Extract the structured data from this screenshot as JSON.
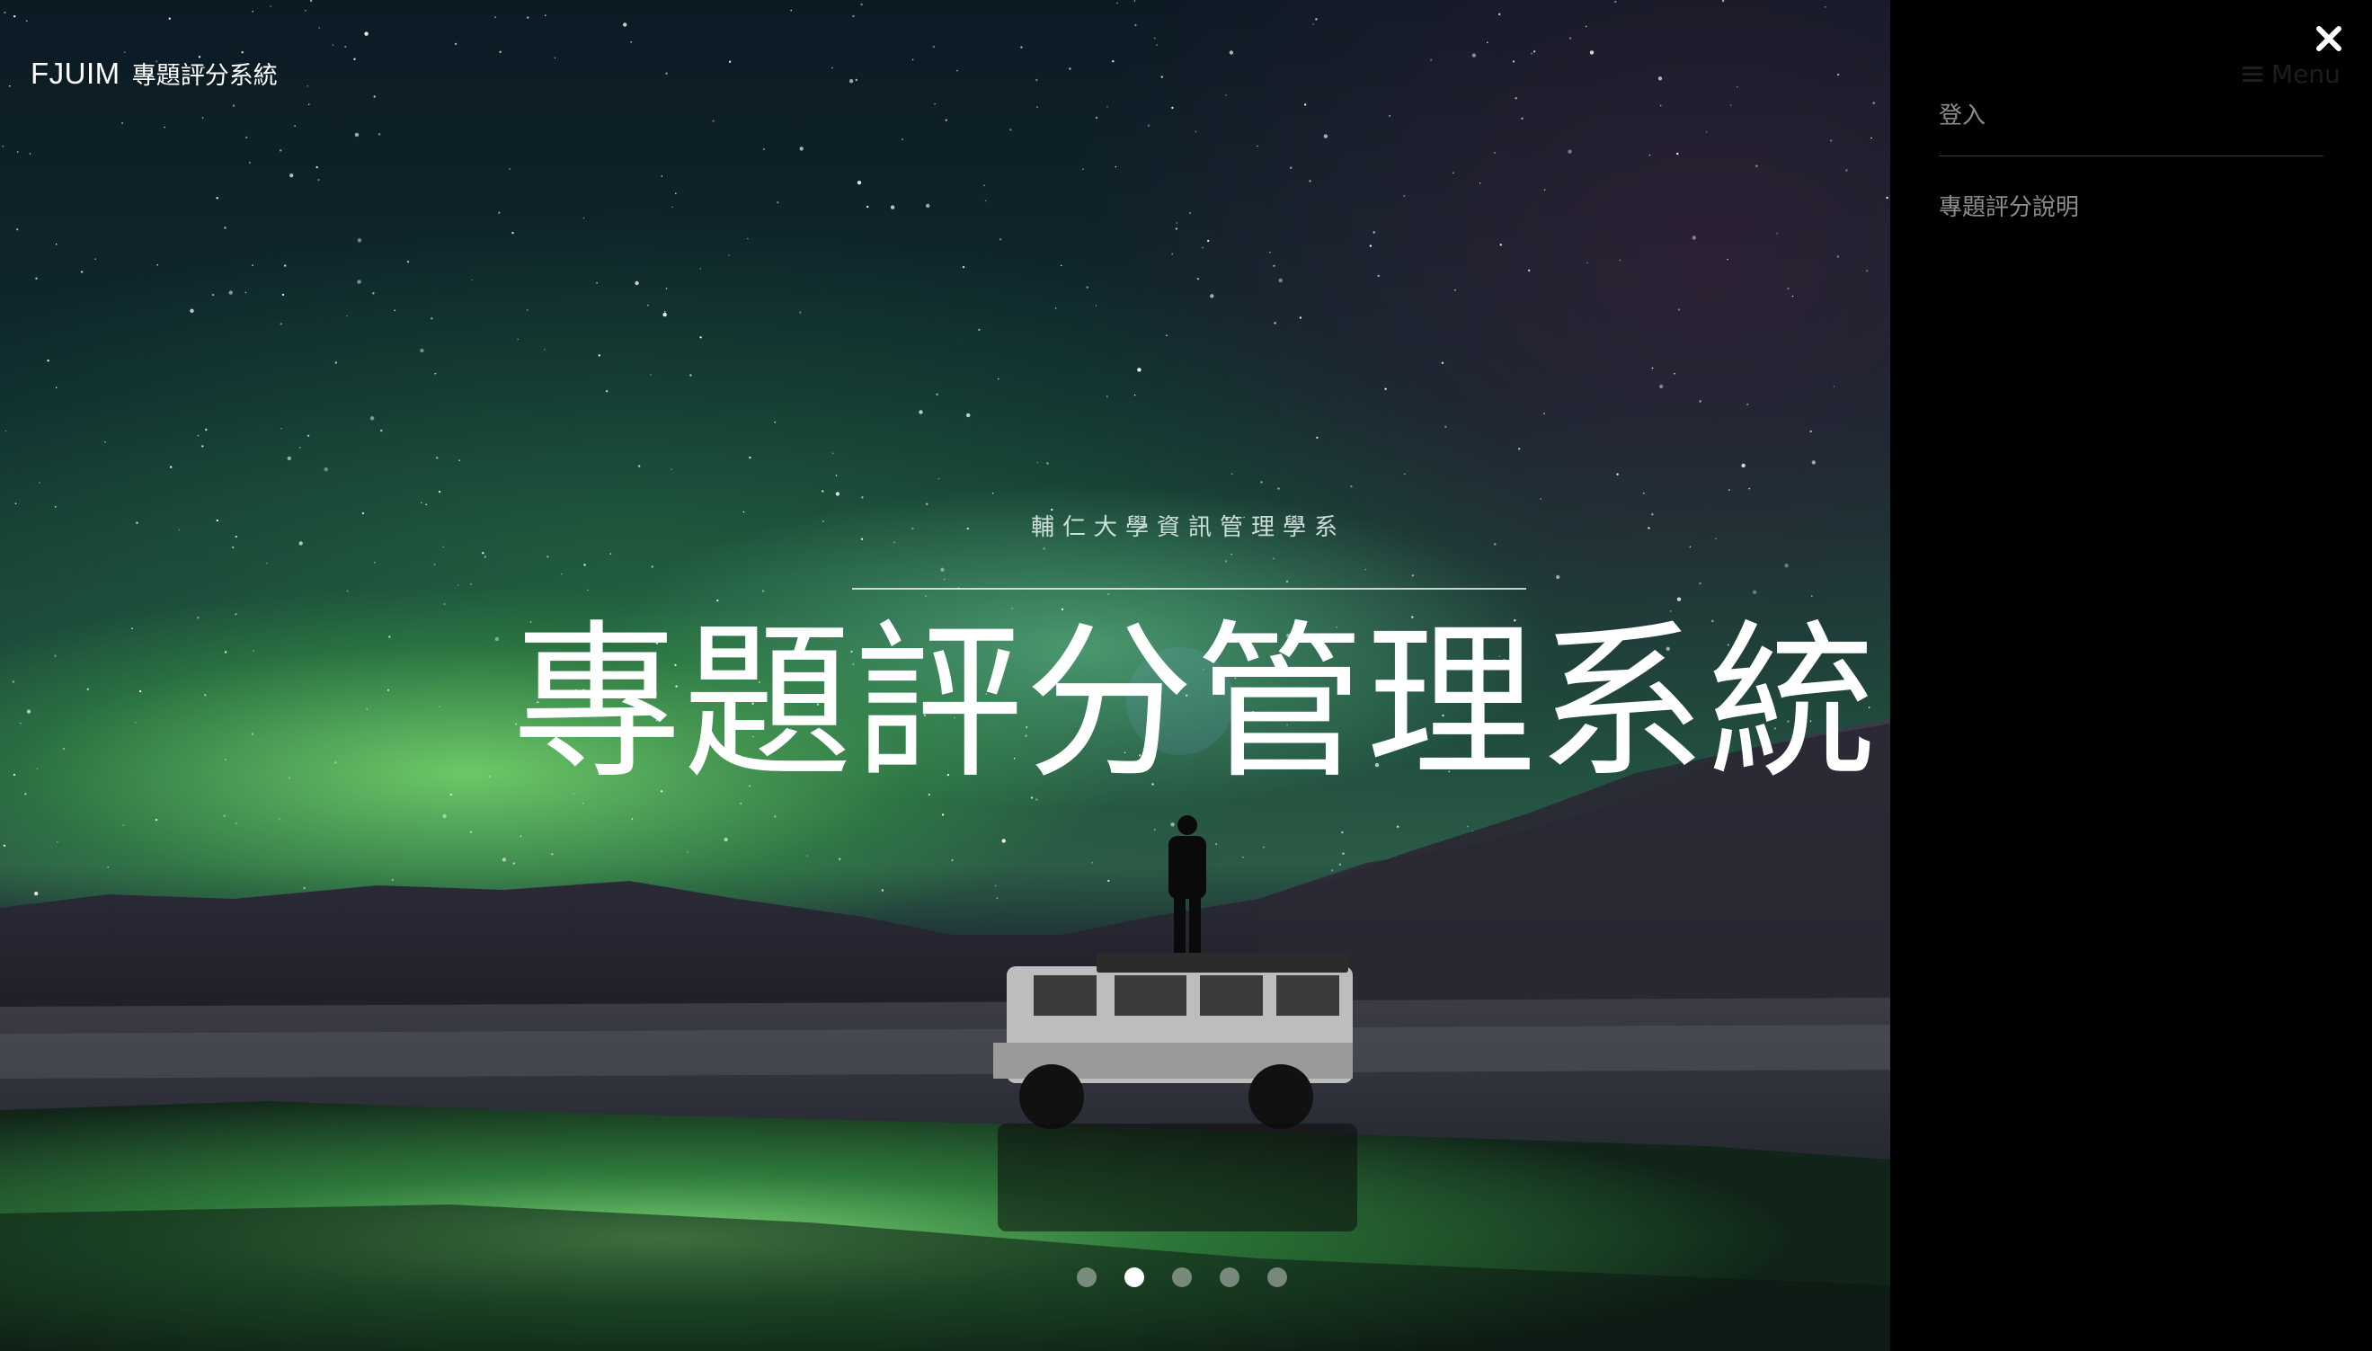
{
  "brand": {
    "main": "FJUIM",
    "sub": "專題評分系統"
  },
  "hero": {
    "subtitle": "輔仁大學資訊管理學系",
    "title": "專題評分管理系統",
    "background": "aurora-night-landscape-image"
  },
  "carousel": {
    "total": 5,
    "active_index": 1
  },
  "side_menu": {
    "toggle_label": "Menu",
    "items": [
      {
        "label": "登入"
      },
      {
        "label": "專題評分說明"
      }
    ],
    "close_icon": "close-icon"
  },
  "colors": {
    "panel_bg": "#000000",
    "menu_text": "#8c8c8c",
    "title_text": "#ffffff",
    "dot_active": "#ffffff",
    "dot_inactive": "#c8c8c8"
  }
}
